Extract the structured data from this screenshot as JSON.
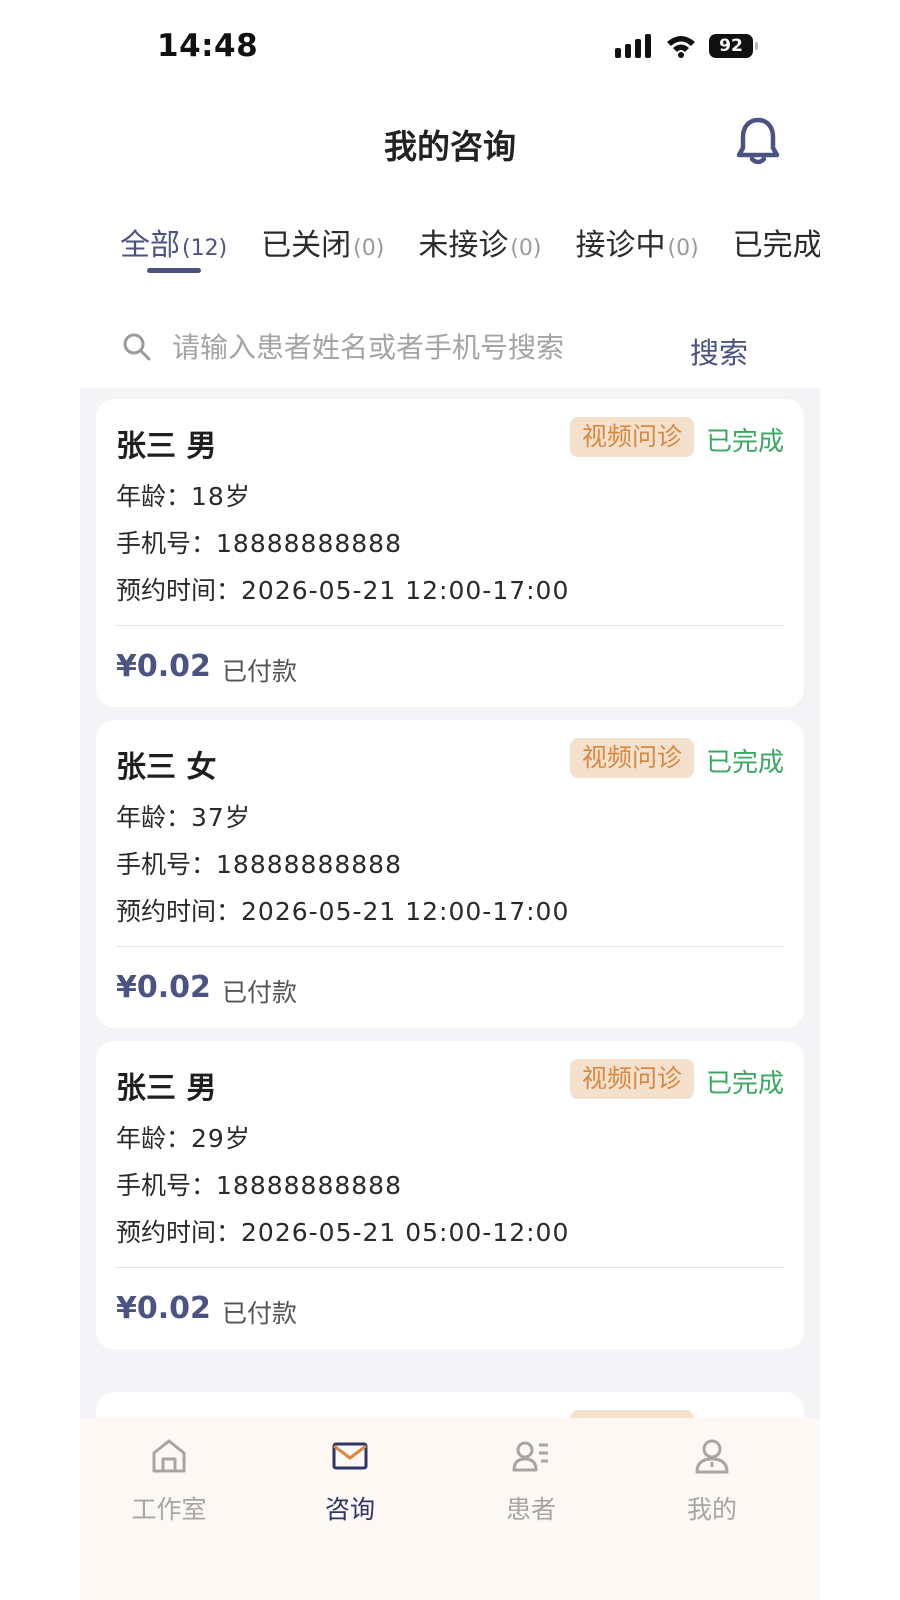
{
  "status_bar": {
    "time": "14:48",
    "battery": "92"
  },
  "header": {
    "title": "我的咨询",
    "bell_icon": "bell-icon"
  },
  "tabs": [
    {
      "label": "全部",
      "count": "(12)",
      "active": true
    },
    {
      "label": "已关闭",
      "count": "(0)"
    },
    {
      "label": "未接诊",
      "count": "(0)"
    },
    {
      "label": "接诊中",
      "count": "(0)"
    },
    {
      "label": "已完成",
      "count": "("
    }
  ],
  "search": {
    "placeholder": "请输入患者姓名或者手机号搜索",
    "button": "搜索"
  },
  "cards": [
    {
      "name": "张三 男",
      "tag": "视频问诊",
      "status": "已完成",
      "age_label": "年龄：",
      "age": "18岁",
      "phone_label": "手机号：",
      "phone": "18888888888",
      "time_label": "预约时间：",
      "time": "2026-05-21 12:00-17:00",
      "price": "¥0.02",
      "payment": "已付款"
    },
    {
      "name": "张三 女",
      "tag": "视频问诊",
      "status": "已完成",
      "age_label": "年龄：",
      "age": "37岁",
      "phone_label": "手机号：",
      "phone": "18888888888",
      "time_label": "预约时间：",
      "time": "2026-05-21 12:00-17:00",
      "price": "¥0.02",
      "payment": "已付款"
    },
    {
      "name": "张三 男",
      "tag": "视频问诊",
      "status": "已完成",
      "age_label": "年龄：",
      "age": "29岁",
      "phone_label": "手机号：",
      "phone": "18888888888",
      "time_label": "预约时间：",
      "time": "2026-05-21 05:00-12:00",
      "price": "¥0.02",
      "payment": "已付款"
    }
  ],
  "bottom_nav": [
    {
      "label": "工作室",
      "icon": "home-icon"
    },
    {
      "label": "咨询",
      "icon": "mail-icon",
      "active": true
    },
    {
      "label": "患者",
      "icon": "patient-icon"
    },
    {
      "label": "我的",
      "icon": "user-icon"
    }
  ],
  "colors": {
    "accent": "#4b5382",
    "completed": "#3aa862",
    "tag_bg": "#f3e1cd",
    "tag_text": "#d8893f",
    "list_bg": "#f4f4f6",
    "nav_bg": "#fdf8f4"
  }
}
